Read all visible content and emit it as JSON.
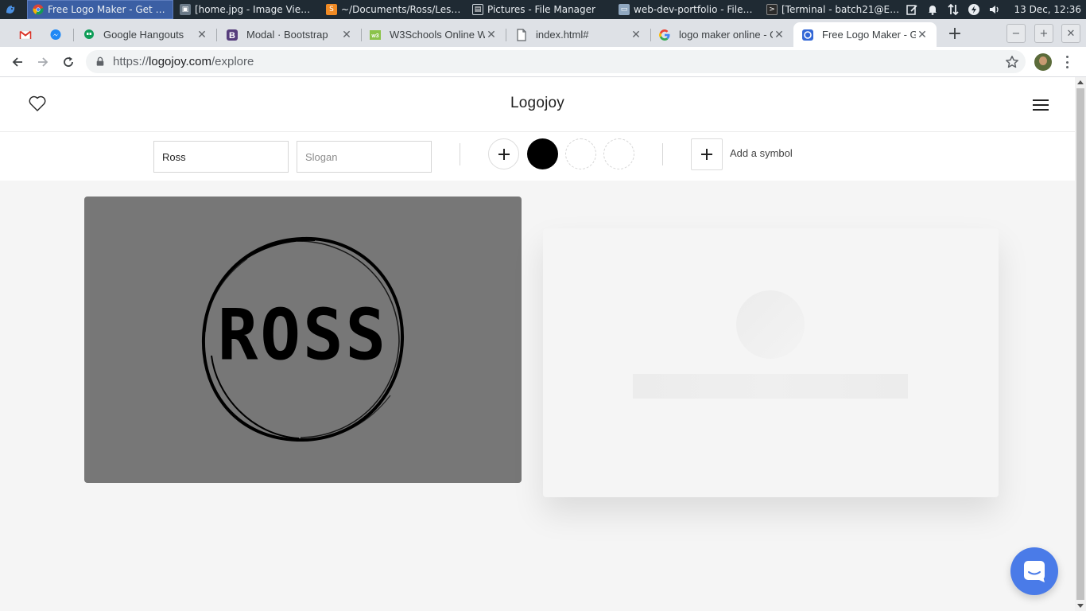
{
  "taskbar": {
    "tasks": [
      {
        "label": "Free Logo Maker - Get Cu...",
        "icon": "chrome-icon",
        "active": true
      },
      {
        "label": "[home.jpg - Image Viewer ...",
        "icon": "image-viewer-icon",
        "active": false
      },
      {
        "label": "~/Documents/Ross/Lesso...",
        "icon": "sublime-text-icon",
        "active": false
      },
      {
        "label": "Pictures - File Manager",
        "icon": "file-manager-icon",
        "active": false
      },
      {
        "label": "web-dev-portfolio - File M...",
        "icon": "folder-icon",
        "active": false
      },
      {
        "label": "[Terminal - batch21@ENZ...",
        "icon": "terminal-icon",
        "active": false
      }
    ],
    "tray": [
      "notes-icon",
      "bell-icon",
      "network-arrows-icon",
      "power-icon",
      "volume-icon"
    ],
    "clock": "13 Dec, 12:36"
  },
  "browser": {
    "tabs": [
      {
        "label": "",
        "icon": "gmail-icon",
        "active": false
      },
      {
        "label": "",
        "icon": "messenger-icon",
        "active": false
      },
      {
        "label": "Google Hangouts",
        "icon": "hangouts-icon",
        "active": false
      },
      {
        "label": "Modal · Bootstrap",
        "icon": "bootstrap-icon",
        "active": false
      },
      {
        "label": "W3Schools Online We",
        "icon": "w3schools-icon",
        "active": false
      },
      {
        "label": "index.html#",
        "icon": "document-icon",
        "active": false
      },
      {
        "label": "logo maker online - G",
        "icon": "google-icon",
        "active": false
      },
      {
        "label": "Free Logo Maker - Ge",
        "icon": "logojoy-icon",
        "active": true
      }
    ],
    "url_prefix": "https://",
    "url_host": "logojoy.com",
    "url_path": "/explore"
  },
  "site": {
    "brand": "Logojoy",
    "company_name_value": "Ross",
    "company_name_placeholder": "",
    "slogan_placeholder": "Slogan",
    "slogan_value": "",
    "add_symbol_label": "Add a symbol",
    "selected_color": "#000000",
    "logo_text": "ROSS"
  }
}
